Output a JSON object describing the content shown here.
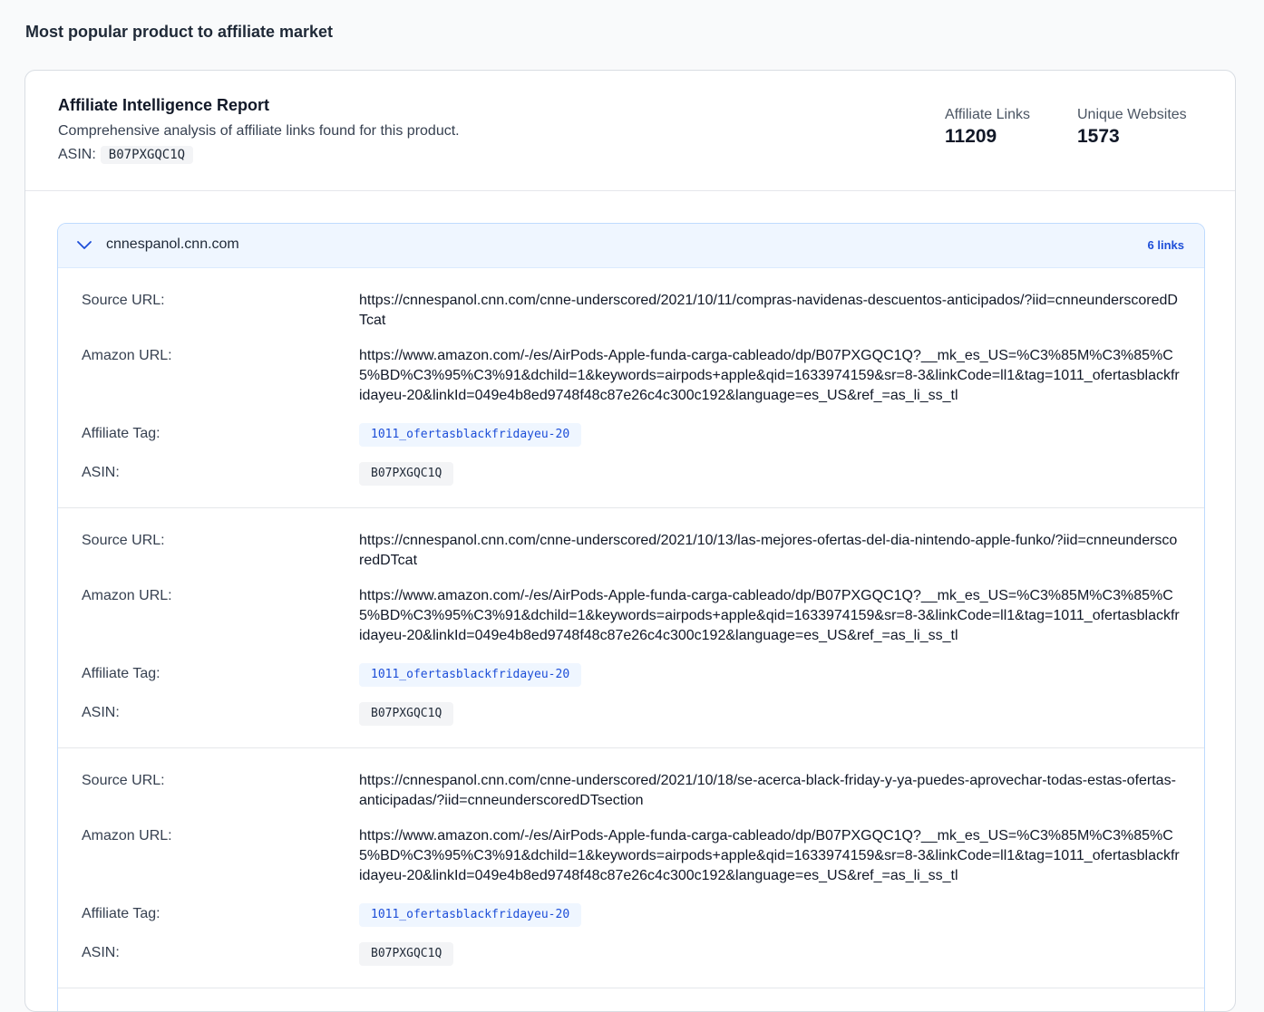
{
  "page": {
    "title": "Most popular product to affiliate market"
  },
  "report": {
    "title": "Affiliate Intelligence Report",
    "description": "Comprehensive analysis of affiliate links found for this product.",
    "asin_label": "ASIN:",
    "asin_value": "B07PXGQC1Q",
    "stats": {
      "affiliate_links_label": "Affiliate Links",
      "affiliate_links_value": "11209",
      "unique_websites_label": "Unique Websites",
      "unique_websites_value": "1573"
    }
  },
  "site_group": {
    "domain": "cnnespanol.cnn.com",
    "link_count": "6 links",
    "expanded": true,
    "labels": {
      "source": "Source URL:",
      "amazon": "Amazon URL:",
      "tag": "Affiliate Tag:",
      "asin": "ASIN:"
    },
    "links": [
      {
        "source_url": "https://cnnespanol.cnn.com/cnne-underscored/2021/10/11/compras-navidenas-descuentos-anticipados/?iid=cnneunderscoredDTcat",
        "amazon_url": "https://www.amazon.com/-/es/AirPods-Apple-funda-carga-cableado/dp/B07PXGQC1Q?__mk_es_US=%C3%85M%C3%85%C5%BD%C3%95%C3%91&dchild=1&keywords=airpods+apple&qid=1633974159&sr=8-3&linkCode=ll1&tag=1011_ofertasblackfridayeu-20&linkId=049e4b8ed9748f48c87e26c4c300c192&language=es_US&ref_=as_li_ss_tl",
        "affiliate_tag": "1011_ofertasblackfridayeu-20",
        "asin": "B07PXGQC1Q"
      },
      {
        "source_url": "https://cnnespanol.cnn.com/cnne-underscored/2021/10/13/las-mejores-ofertas-del-dia-nintendo-apple-funko/?iid=cnneunderscoredDTcat",
        "amazon_url": "https://www.amazon.com/-/es/AirPods-Apple-funda-carga-cableado/dp/B07PXGQC1Q?__mk_es_US=%C3%85M%C3%85%C5%BD%C3%95%C3%91&dchild=1&keywords=airpods+apple&qid=1633974159&sr=8-3&linkCode=ll1&tag=1011_ofertasblackfridayeu-20&linkId=049e4b8ed9748f48c87e26c4c300c192&language=es_US&ref_=as_li_ss_tl",
        "affiliate_tag": "1011_ofertasblackfridayeu-20",
        "asin": "B07PXGQC1Q"
      },
      {
        "source_url": "https://cnnespanol.cnn.com/cnne-underscored/2021/10/18/se-acerca-black-friday-y-ya-puedes-aprovechar-todas-estas-ofertas-anticipadas/?iid=cnneunderscoredDTsection",
        "amazon_url": "https://www.amazon.com/-/es/AirPods-Apple-funda-carga-cableado/dp/B07PXGQC1Q?__mk_es_US=%C3%85M%C3%85%C5%BD%C3%95%C3%91&dchild=1&keywords=airpods+apple&qid=1633974159&sr=8-3&linkCode=ll1&tag=1011_ofertasblackfridayeu-20&linkId=049e4b8ed9748f48c87e26c4c300c192&language=es_US&ref_=as_li_ss_tl",
        "affiliate_tag": "1011_ofertasblackfridayeu-20",
        "asin": "B07PXGQC1Q"
      }
    ]
  },
  "icons": {
    "expand_toggle": "chevron-down-icon"
  },
  "colors": {
    "accent": "#1d4ed8",
    "group_header_bg": "#eff6ff",
    "group_border": "#bfdbfe",
    "chip_bg": "#f3f4f6"
  }
}
